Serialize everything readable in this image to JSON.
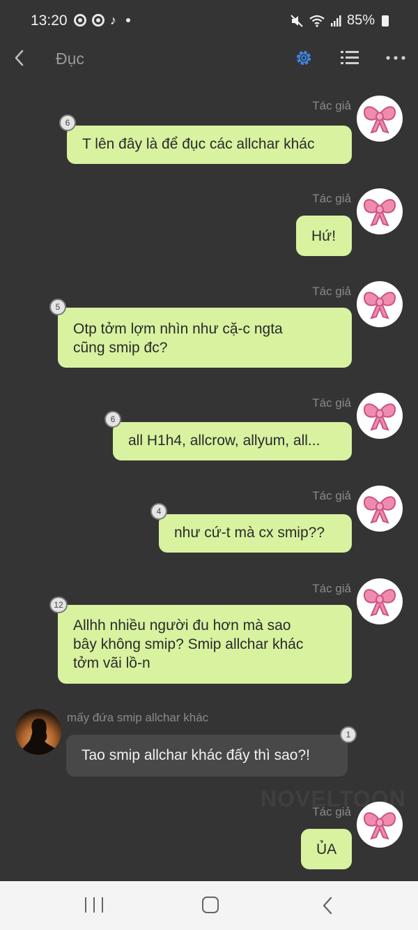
{
  "status_bar": {
    "time": "13:20",
    "battery_percent": "85%",
    "icons": [
      "chrome-icon",
      "chrome-icon",
      "tiktok-icon",
      "notification-dot-icon",
      "mute-icon",
      "wifi-icon",
      "signal-icon",
      "battery-icon"
    ]
  },
  "app_bar": {
    "title": "Đục",
    "accent_color": "#3d86e8",
    "icons": [
      "back-icon",
      "gear-icon",
      "list-icon",
      "more-icon"
    ]
  },
  "messages": [
    {
      "sender": "Tác giả",
      "side": "right",
      "text": "T lên đây là để đục các allchar khác",
      "count": "6"
    },
    {
      "sender": "Tác giả",
      "side": "right",
      "text": "Hứ!",
      "count": ""
    },
    {
      "sender": "Tác giả",
      "side": "right",
      "text": "Otp tởm lợm nhìn như cặ-c ngta\ncũng smip đc?",
      "count": "5"
    },
    {
      "sender": "Tác giả",
      "side": "right",
      "text": "all H1h4, allcrow, allyum, all...",
      "count": "6"
    },
    {
      "sender": "Tác giả",
      "side": "right",
      "text": "như cứ-t mà cx smip??",
      "count": "4"
    },
    {
      "sender": "Tác giả",
      "side": "right",
      "text": "Allhh nhiều người đu hơn mà sao\nbây không smip? Smip allchar khác\ntởm vãi lồ-n",
      "count": "12"
    },
    {
      "sender": "mấy đứa smip allchar khác",
      "side": "left",
      "text": "Tao smip allchar khác đấy thì sao?!",
      "count": "1"
    },
    {
      "sender": "Tác giả",
      "side": "right",
      "text": "ỦA",
      "count": ""
    }
  ],
  "watermark": "NOVELTOON",
  "colors": {
    "background": "#343434",
    "author_bubble": "#d8f2a0",
    "other_bubble": "#484848",
    "nav_bar": "#f4f4f4"
  },
  "nav_bar": {
    "icons": [
      "recent-apps-icon",
      "home-icon",
      "nav-back-icon"
    ]
  }
}
